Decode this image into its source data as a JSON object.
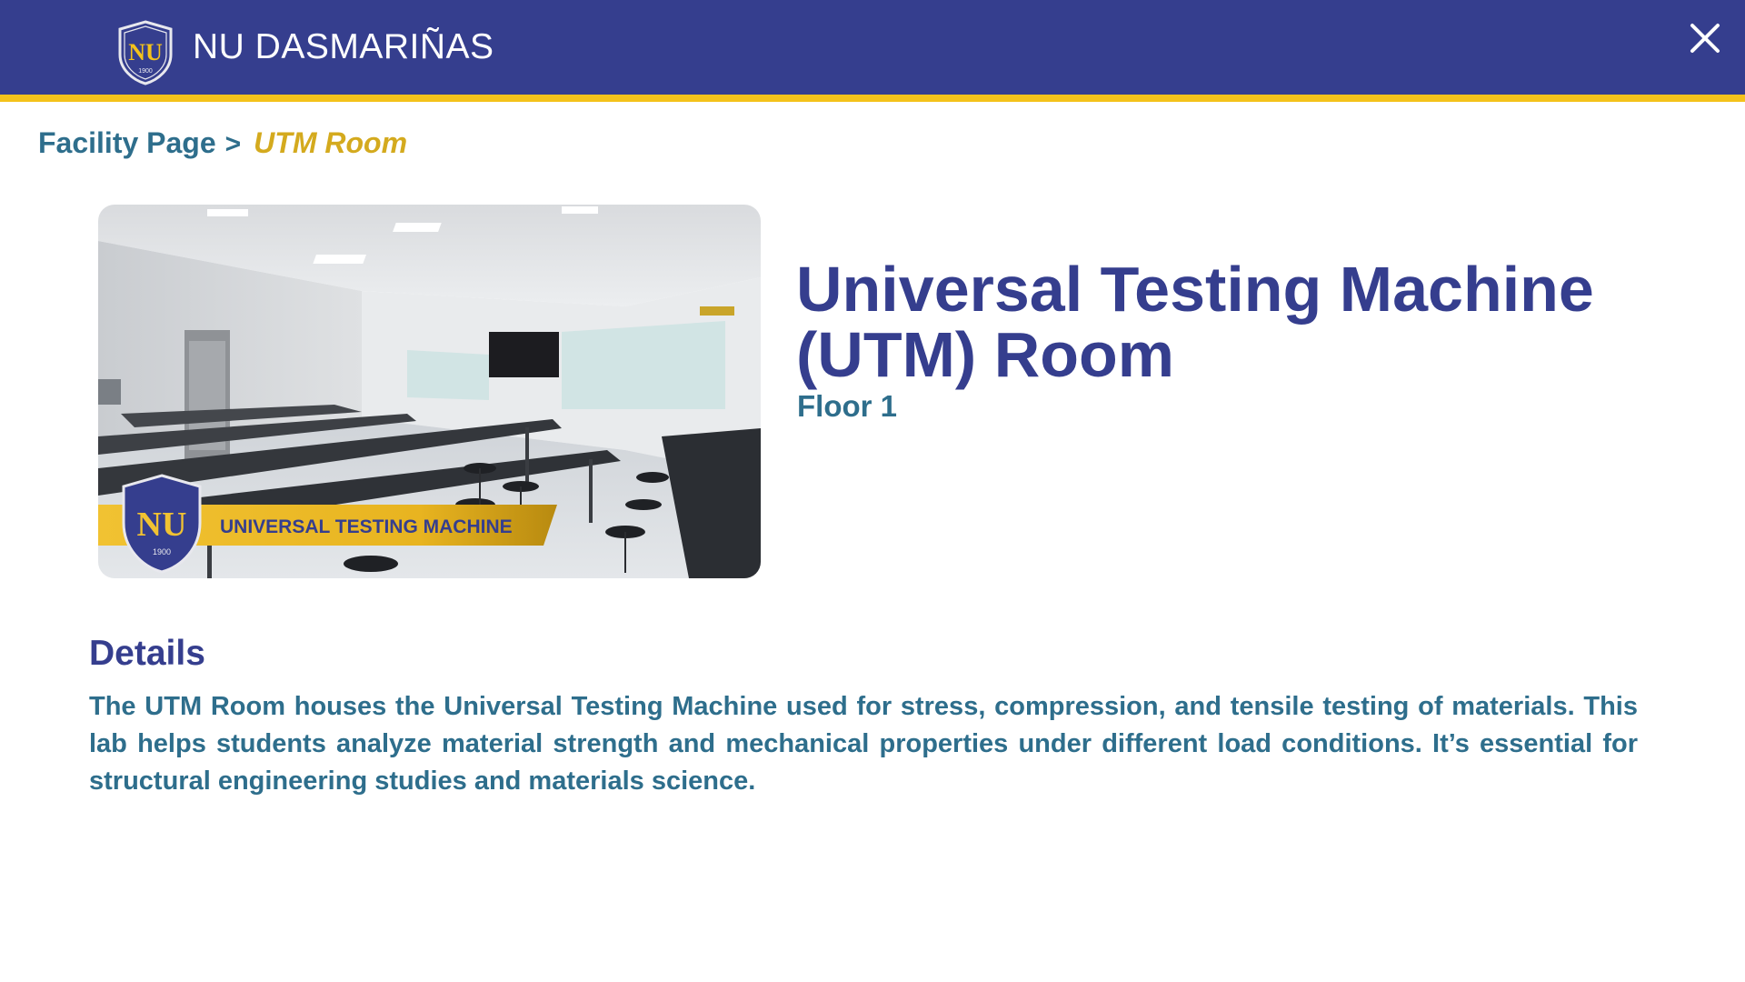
{
  "header": {
    "brand": "NU DASMARIÑAS",
    "logo_text": "NU",
    "logo_year": "1900"
  },
  "breadcrumb": {
    "root": "Facility Page",
    "separator": ">",
    "current": "UTM Room"
  },
  "photo": {
    "banner_text": "UNIVERSAL TESTING MACHINE",
    "logo_text": "NU",
    "logo_year": "1900"
  },
  "facility": {
    "title": "Universal Testing Machine (UTM) Room",
    "floor": "Floor 1"
  },
  "details": {
    "heading": "Details",
    "body": "The UTM Room houses the Universal Testing Machine used for stress, compression, and tensile testing of materials. This lab helps students analyze material strength and mechanical properties under different load conditions. It’s essential for structural engineering studies and materials science."
  },
  "colors": {
    "primary": "#353e8e",
    "accent": "#f4c21b",
    "secondary_text": "#2e6e8c",
    "breadcrumb_current": "#d4aa1e"
  },
  "icons": {
    "close": "close-icon",
    "logo": "nu-shield-logo"
  }
}
